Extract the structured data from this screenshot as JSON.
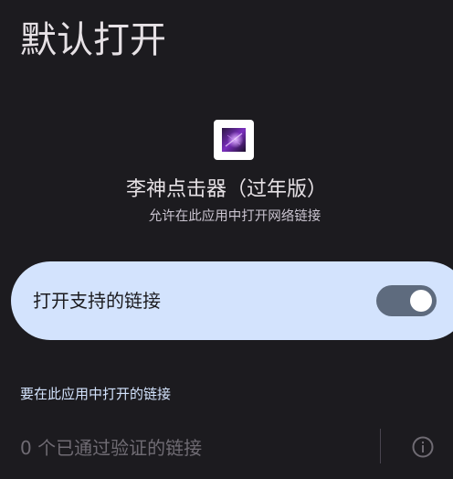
{
  "header": {
    "title": "默认打开"
  },
  "app": {
    "icon": "app-icon",
    "name": "李神点击器（过年版）",
    "subtitle": "允许在此应用中打开网络链接"
  },
  "open_supported_links": {
    "label": "打开支持的链接",
    "enabled": true
  },
  "links_section": {
    "header": "要在此应用中打开的链接",
    "verified_links": "0 个已通过验证的链接",
    "info_icon": "info-icon"
  },
  "colors": {
    "background": "#1c1b1f",
    "card": "#d3e3fd",
    "switch_track": "#5e6b7e",
    "accent_text": "#d3e3fd"
  }
}
